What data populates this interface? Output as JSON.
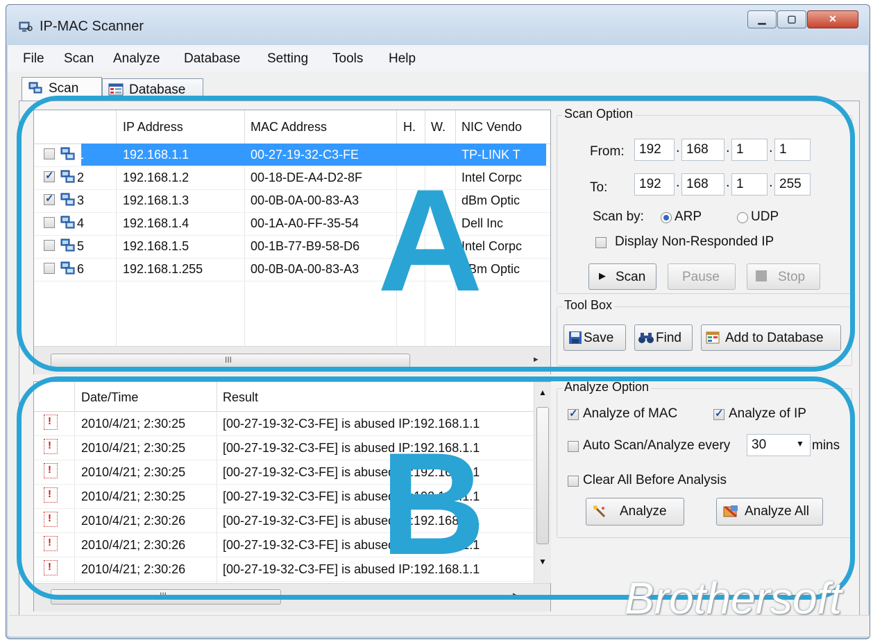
{
  "window": {
    "title": "IP-MAC Scanner"
  },
  "menu": [
    "File",
    "Scan",
    "Analyze",
    "Database",
    "Setting",
    "Tools",
    "Help"
  ],
  "tabs": [
    {
      "label": "Scan"
    },
    {
      "label": "Database"
    }
  ],
  "scan_table": {
    "columns": [
      "IP Address",
      "MAC Address",
      "H.",
      "W.",
      "NIC Vendo"
    ],
    "rows": [
      {
        "num": "1",
        "checked": false,
        "ip": "192.168.1.1",
        "mac": "00-27-19-32-C3-FE",
        "vendor": "TP-LINK T",
        "selected": true
      },
      {
        "num": "2",
        "checked": true,
        "ip": "192.168.1.2",
        "mac": "00-18-DE-A4-D2-8F",
        "vendor": "Intel Corpc",
        "selected": false
      },
      {
        "num": "3",
        "checked": true,
        "ip": "192.168.1.3",
        "mac": "00-0B-0A-00-83-A3",
        "vendor": "dBm Optic",
        "selected": false
      },
      {
        "num": "4",
        "checked": false,
        "ip": "192.168.1.4",
        "mac": "00-1A-A0-FF-35-54",
        "vendor": "Dell Inc",
        "selected": false
      },
      {
        "num": "5",
        "checked": false,
        "ip": "192.168.1.5",
        "mac": "00-1B-77-B9-58-D6",
        "vendor": "Intel Corpc",
        "selected": false
      },
      {
        "num": "6",
        "checked": false,
        "ip": "192.168.1.255",
        "mac": "00-0B-0A-00-83-A3",
        "vendor": "dBm Optic",
        "selected": false
      }
    ],
    "scroll_grip": "III"
  },
  "scan_option": {
    "title": "Scan Option",
    "from_label": "From:",
    "from": [
      "192",
      "168",
      "1",
      "1"
    ],
    "to_label": "To:",
    "to": [
      "192",
      "168",
      "1",
      "255"
    ],
    "scan_by_label": "Scan by:",
    "arp_label": "ARP",
    "udp_label": "UDP",
    "scan_by_selected": "ARP",
    "display_nonresponded_label": "Display Non-Responded IP",
    "display_nonresponded_checked": false,
    "scan_button": "Scan",
    "pause_button": "Pause",
    "stop_button": "Stop"
  },
  "tool_box": {
    "title": "Tool Box",
    "save_button": "Save",
    "find_button": "Find",
    "add_db_button": "Add to Database"
  },
  "result_table": {
    "columns": [
      "Date/Time",
      "Result"
    ],
    "rows": [
      {
        "datetime": "2010/4/21; 2:30:25",
        "result": "[00-27-19-32-C3-FE] is abused IP:192.168.1.1"
      },
      {
        "datetime": "2010/4/21; 2:30:25",
        "result": "[00-27-19-32-C3-FE] is abused IP:192.168.1.1"
      },
      {
        "datetime": "2010/4/21; 2:30:25",
        "result": "[00-27-19-32-C3-FE] is abused IP:192.168.1.1"
      },
      {
        "datetime": "2010/4/21; 2:30:25",
        "result": "[00-27-19-32-C3-FE] is abused IP:192.168.1.1"
      },
      {
        "datetime": "2010/4/21; 2:30:26",
        "result": "[00-27-19-32-C3-FE] is abused IP:192.168.1.1"
      },
      {
        "datetime": "2010/4/21; 2:30:26",
        "result": "[00-27-19-32-C3-FE] is abused IP:192.168.1.1"
      },
      {
        "datetime": "2010/4/21; 2:30:26",
        "result": "[00-27-19-32-C3-FE] is abused IP:192.168.1.1"
      }
    ],
    "scroll_grip": "III"
  },
  "analyze_option": {
    "title": "Analyze Option",
    "analyze_mac_label": "Analyze of MAC",
    "analyze_mac_checked": true,
    "analyze_ip_label": "Analyze of IP",
    "analyze_ip_checked": true,
    "auto_scan_label": "Auto Scan/Analyze every",
    "auto_scan_checked": false,
    "auto_scan_value": "30",
    "mins_label": "mins",
    "clear_all_label": "Clear All Before Analysis",
    "clear_all_checked": false,
    "analyze_button": "Analyze",
    "analyze_all_button": "Analyze All"
  },
  "annotations": {
    "a_label": "A",
    "b_label": "B",
    "ring_color": "#2aa4d4"
  },
  "watermark": {
    "text": "Brothersoft"
  },
  "colors": {
    "selection": "#3399ff",
    "accent": "#2aa4d4"
  }
}
